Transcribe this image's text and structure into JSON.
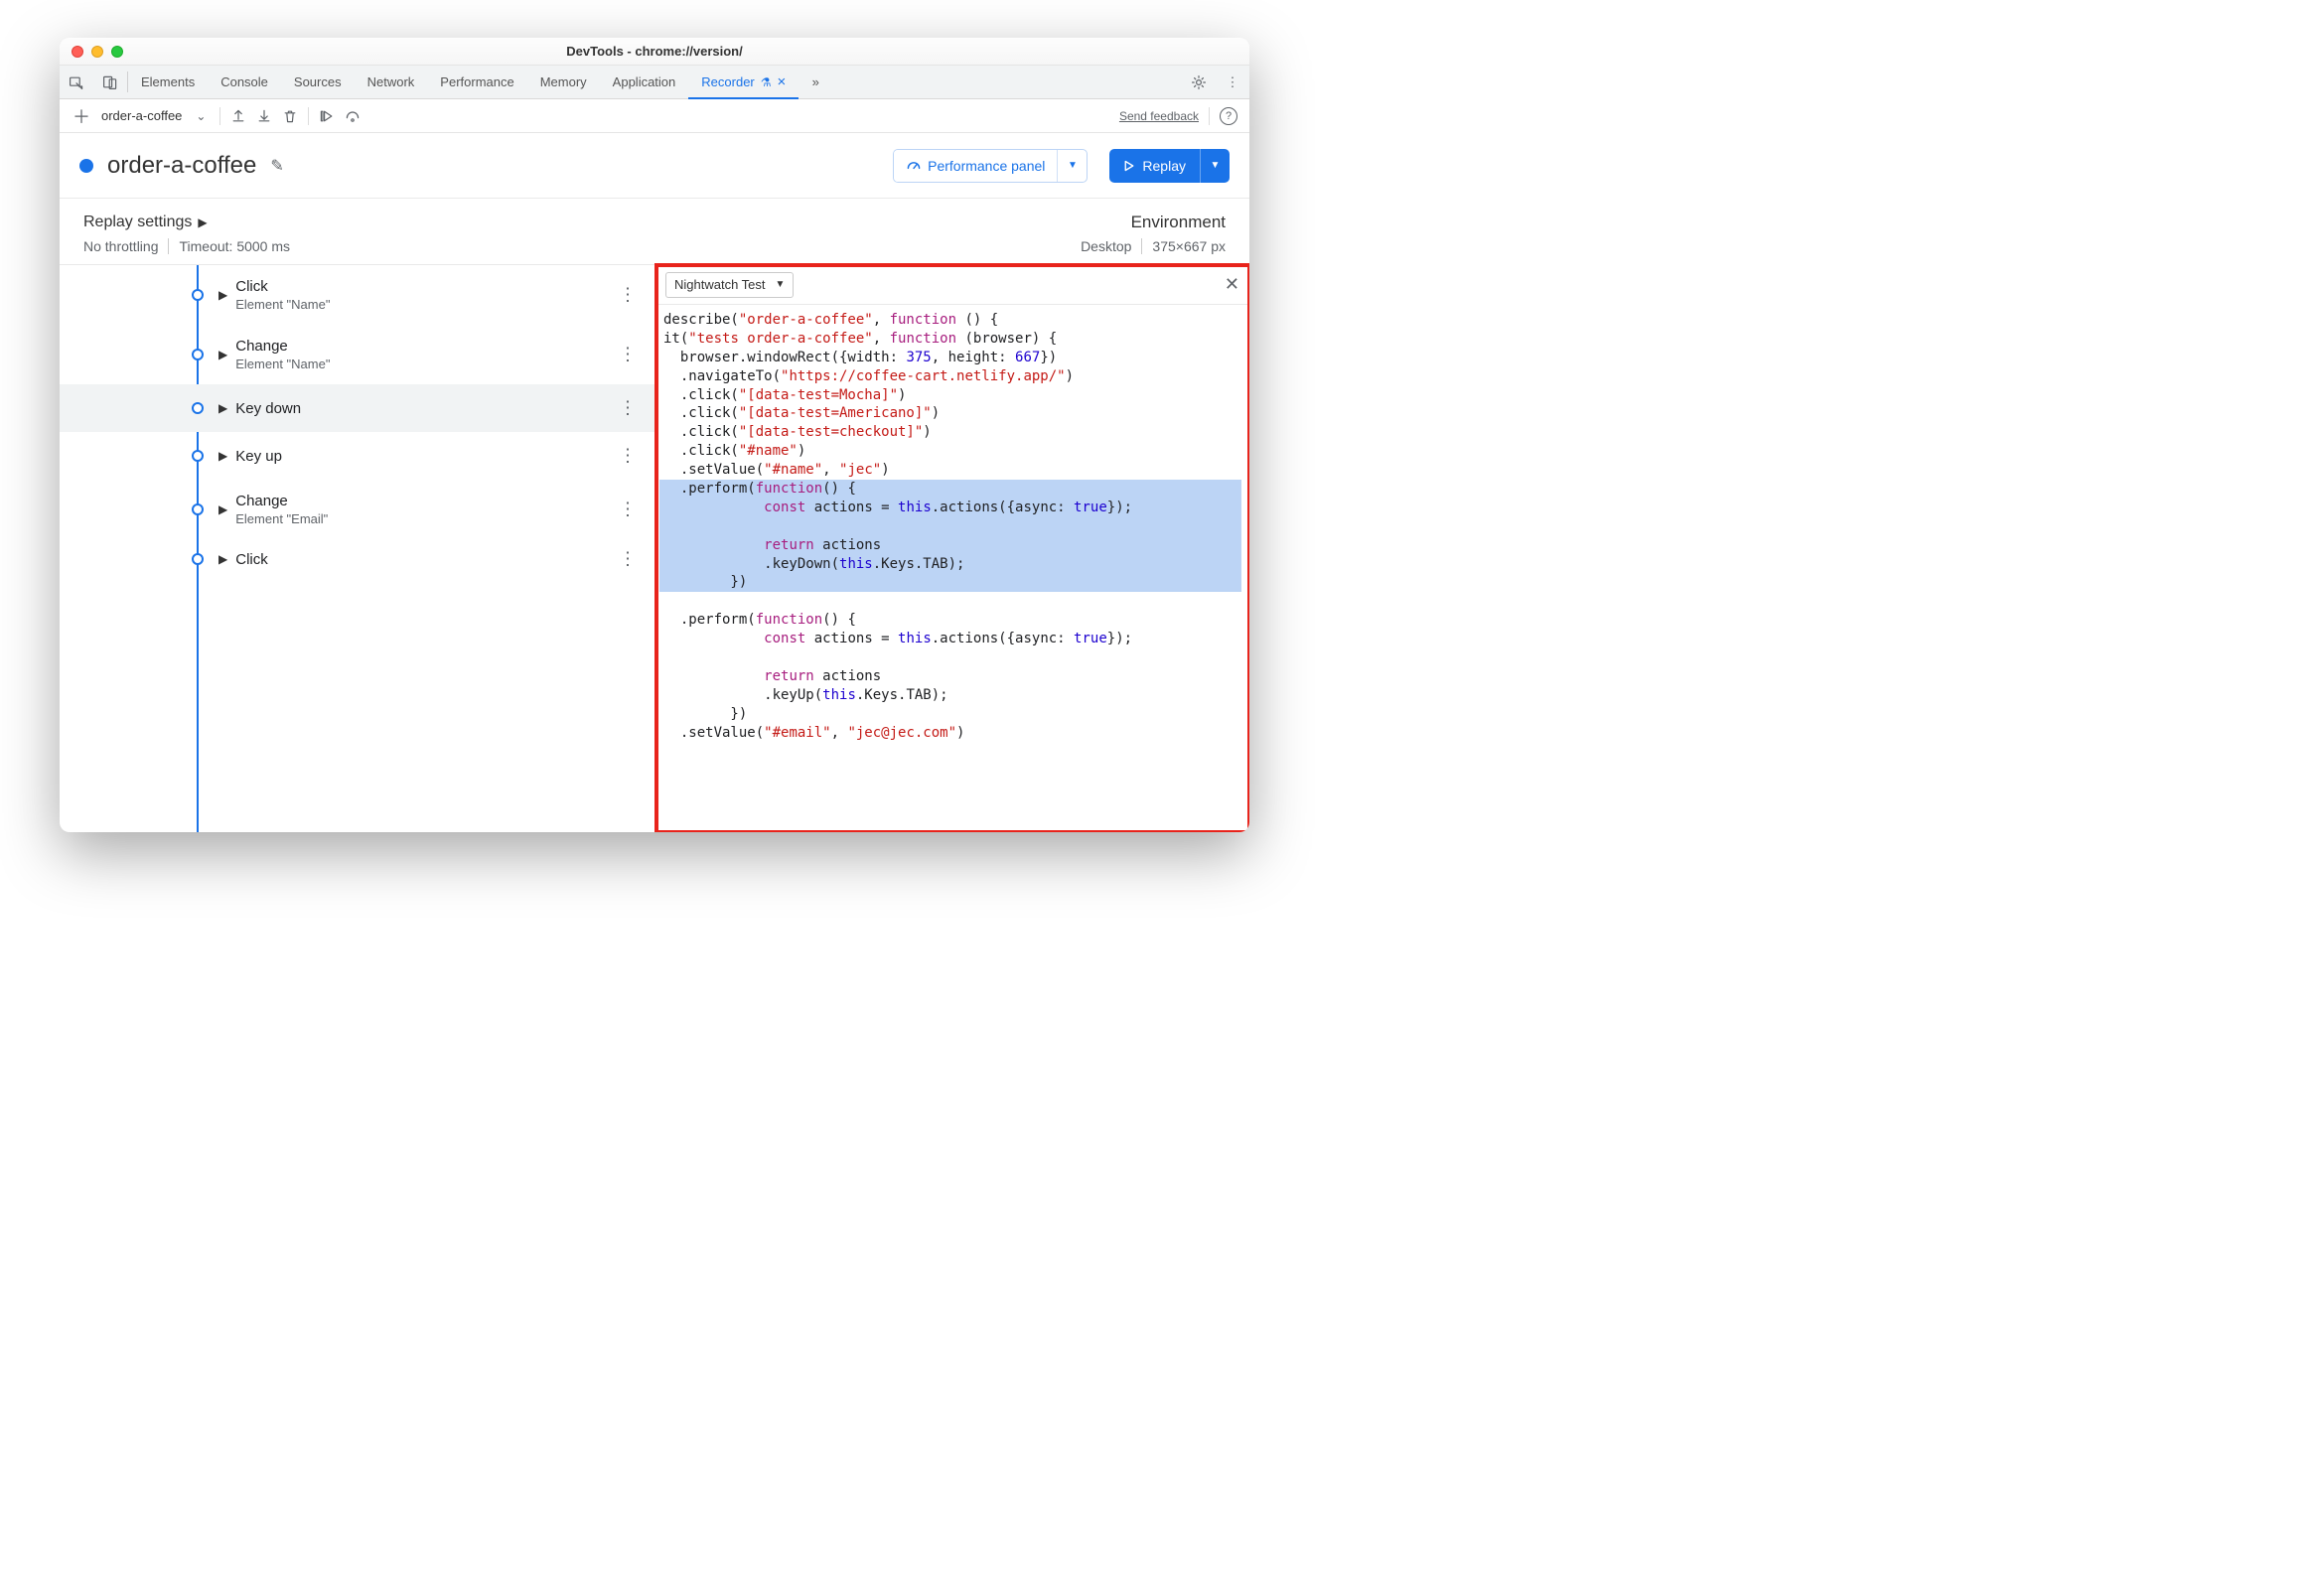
{
  "titlebar": {
    "title": "DevTools - chrome://version/"
  },
  "tabs": {
    "elements": "Elements",
    "console": "Console",
    "sources": "Sources",
    "network": "Network",
    "performance": "Performance",
    "memory": "Memory",
    "application": "Application",
    "recorder": "Recorder",
    "close_x": "×",
    "overflow_glyph": "»"
  },
  "subtool": {
    "recording_name": "order-a-coffee",
    "send_feedback": "Send feedback"
  },
  "rec_title": {
    "name": "order-a-coffee",
    "perf_label": "Performance panel",
    "replay_label": "Replay"
  },
  "settings": {
    "label": "Replay settings",
    "throttling": "No throttling",
    "timeout": "Timeout: 5000 ms",
    "env_label": "Environment",
    "env_value": "Desktop",
    "viewport": "375×667 px"
  },
  "steps": [
    {
      "title": "Click",
      "sub": "Element \"Name\""
    },
    {
      "title": "Change",
      "sub": "Element \"Name\""
    },
    {
      "title": "Key down",
      "sub": ""
    },
    {
      "title": "Key up",
      "sub": ""
    },
    {
      "title": "Change",
      "sub": "Element \"Email\""
    },
    {
      "title": "Click",
      "sub": ""
    }
  ],
  "code": {
    "dropdown_label": "Nightwatch Test",
    "tokens": {
      "describe_str": "\"order-a-coffee\"",
      "it_str": "\"tests order-a-coffee\"",
      "url_str": "\"https://coffee-cart.netlify.app/\"",
      "sel_mocha": "\"[data-test=Mocha]\"",
      "sel_americano": "\"[data-test=Americano]\"",
      "sel_checkout": "\"[data-test=checkout]\"",
      "sel_name": "\"#name\"",
      "val_jec": "\"jec\"",
      "sel_email": "\"#email\"",
      "val_email": "\"jec@jec.com\"",
      "width": "375",
      "height": "667",
      "fn": "function",
      "const": "const",
      "ret": "return",
      "this": "this",
      "true": "true"
    }
  }
}
